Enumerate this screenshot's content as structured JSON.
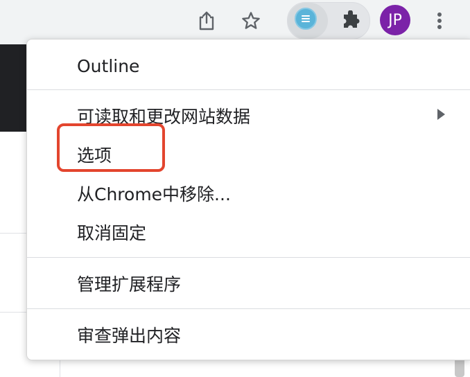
{
  "toolbar": {
    "share_icon": "share-icon",
    "bookmark_icon": "star-icon",
    "extension_icon": "outline-extension-icon",
    "extensions_icon": "puzzle-icon",
    "avatar_initials": "JP",
    "avatar_color": "#7b22a8",
    "menu_icon": "kebab-menu-icon"
  },
  "menu": {
    "title": "Outline",
    "items": [
      {
        "label": "可读取和更改网站数据",
        "has_submenu": true
      },
      {
        "label": "选项",
        "highlighted": true
      },
      {
        "label": "从Chrome中移除..."
      },
      {
        "label": "取消固定"
      },
      {
        "label": "管理扩展程序"
      },
      {
        "label": "审查弹出内容"
      }
    ]
  },
  "colors": {
    "highlight_box": "#e3452e",
    "extension_badge": "#5ab4d9",
    "text": "#202124"
  }
}
